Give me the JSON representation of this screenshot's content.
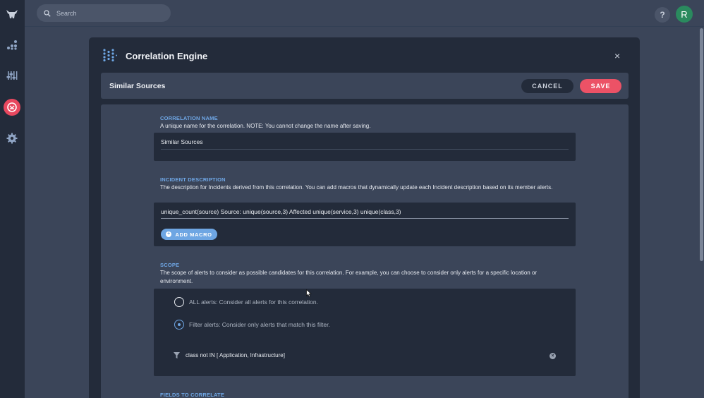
{
  "search": {
    "placeholder": "Search"
  },
  "header": {
    "help_label": "?",
    "avatar_initial": "R"
  },
  "modal": {
    "title": "Correlation Engine",
    "close_label": "×",
    "subheader_title": "Similar Sources",
    "cancel_label": "CANCEL",
    "save_label": "SAVE"
  },
  "sections": {
    "name": {
      "label": "CORRELATION NAME",
      "description": "A unique name for the correlation. NOTE: You cannot change the name after saving.",
      "value": "Similar Sources"
    },
    "incident": {
      "label": "INCIDENT DESCRIPTION",
      "description": "The description for Incidents derived from this correlation. You can add macros that dynamically update each Incident description based on its member alerts.",
      "value": "unique_count(source) Source: unique(source,3) Affected unique(service,3) unique(class,3)",
      "macro_button": "ADD MACRO"
    },
    "scope": {
      "label": "SCOPE",
      "description": "The scope of alerts to consider as possible candidates for this correlation. For example, you can choose to consider only alerts for a specific location or environment.",
      "options": [
        {
          "label": "ALL alerts: Consider all alerts for this correlation.",
          "selected": false
        },
        {
          "label": "Filter alerts: Consider only alerts that match this filter.",
          "selected": true
        }
      ],
      "filter": "class not IN [ Application, Infrastructure]"
    },
    "fields": {
      "label": "FIELDS TO CORRELATE"
    }
  },
  "colors": {
    "accent_blue": "#6ea6e3",
    "save_red": "#ec5266",
    "panel_dark": "#232b3a",
    "background": "#3b4559"
  },
  "icons": [
    "bull-logo-icon",
    "chart-icon",
    "sliders-icon",
    "correlation-icon",
    "gear-icon",
    "search-icon",
    "logo-dots-icon",
    "funnel-icon",
    "clear-icon"
  ]
}
